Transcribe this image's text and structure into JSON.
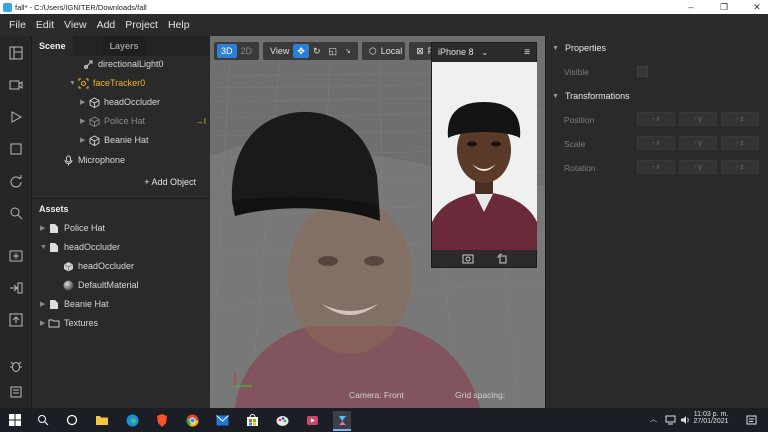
{
  "window": {
    "title": "fall* - C:/Users/IGNITER/Downloads/fall"
  },
  "menu": [
    "File",
    "Edit",
    "View",
    "Add",
    "Project",
    "Help"
  ],
  "scene_panel": {
    "tab_scene": "Scene",
    "tab_layers": "Layers",
    "items": [
      {
        "label": "directionalLight0",
        "icon": "light-icon"
      },
      {
        "label": "faceTracker0",
        "icon": "face-tracker-icon",
        "highlight": "#f2b632"
      },
      {
        "label": "headOccluder",
        "icon": "cube-icon"
      },
      {
        "label": "Police Hat",
        "icon": "cube-icon",
        "dim": true,
        "marker": "→I"
      },
      {
        "label": "Beanie Hat",
        "icon": "cube-icon"
      },
      {
        "label": "Microphone",
        "icon": "microphone-icon"
      }
    ],
    "add_object": "+ Add Object"
  },
  "assets_panel": {
    "title": "Assets",
    "items": [
      {
        "label": "Police Hat",
        "icon": "file-icon"
      },
      {
        "label": "headOccluder",
        "icon": "file-icon"
      },
      {
        "label": "headOccluder",
        "icon": "cube-icon"
      },
      {
        "label": "DefaultMaterial",
        "icon": "material-sphere-icon"
      },
      {
        "label": "Beanie Hat",
        "icon": "file-icon"
      },
      {
        "label": "Textures",
        "icon": "folder-icon"
      }
    ]
  },
  "viewport": {
    "toolbar": {
      "mode_3d": "3D",
      "mode_2d": "2D",
      "view": "View",
      "space": "Local",
      "pivot": "Pi"
    },
    "camera_label": "Camera: Front",
    "grid_label": "Grid spacing:"
  },
  "preview": {
    "device": "iPhone 8"
  },
  "properties": {
    "title": "Properties",
    "visible_label": "Visible",
    "transformations_title": "Transformations",
    "rows": [
      {
        "label": "Position",
        "fields": [
          "- x",
          "- y",
          "- z"
        ]
      },
      {
        "label": "Scale",
        "fields": [
          "- x",
          "- y",
          "- z"
        ]
      },
      {
        "label": "Rotation",
        "fields": [
          "- x",
          "- y",
          "- z"
        ]
      }
    ]
  },
  "taskbar": {
    "time": "11:03 p. m.",
    "date": "27/01/2021"
  },
  "colors": {
    "accent": "#2c7fd6",
    "face_tracker": "#f2b632",
    "shirt": "#6b2a3a"
  }
}
